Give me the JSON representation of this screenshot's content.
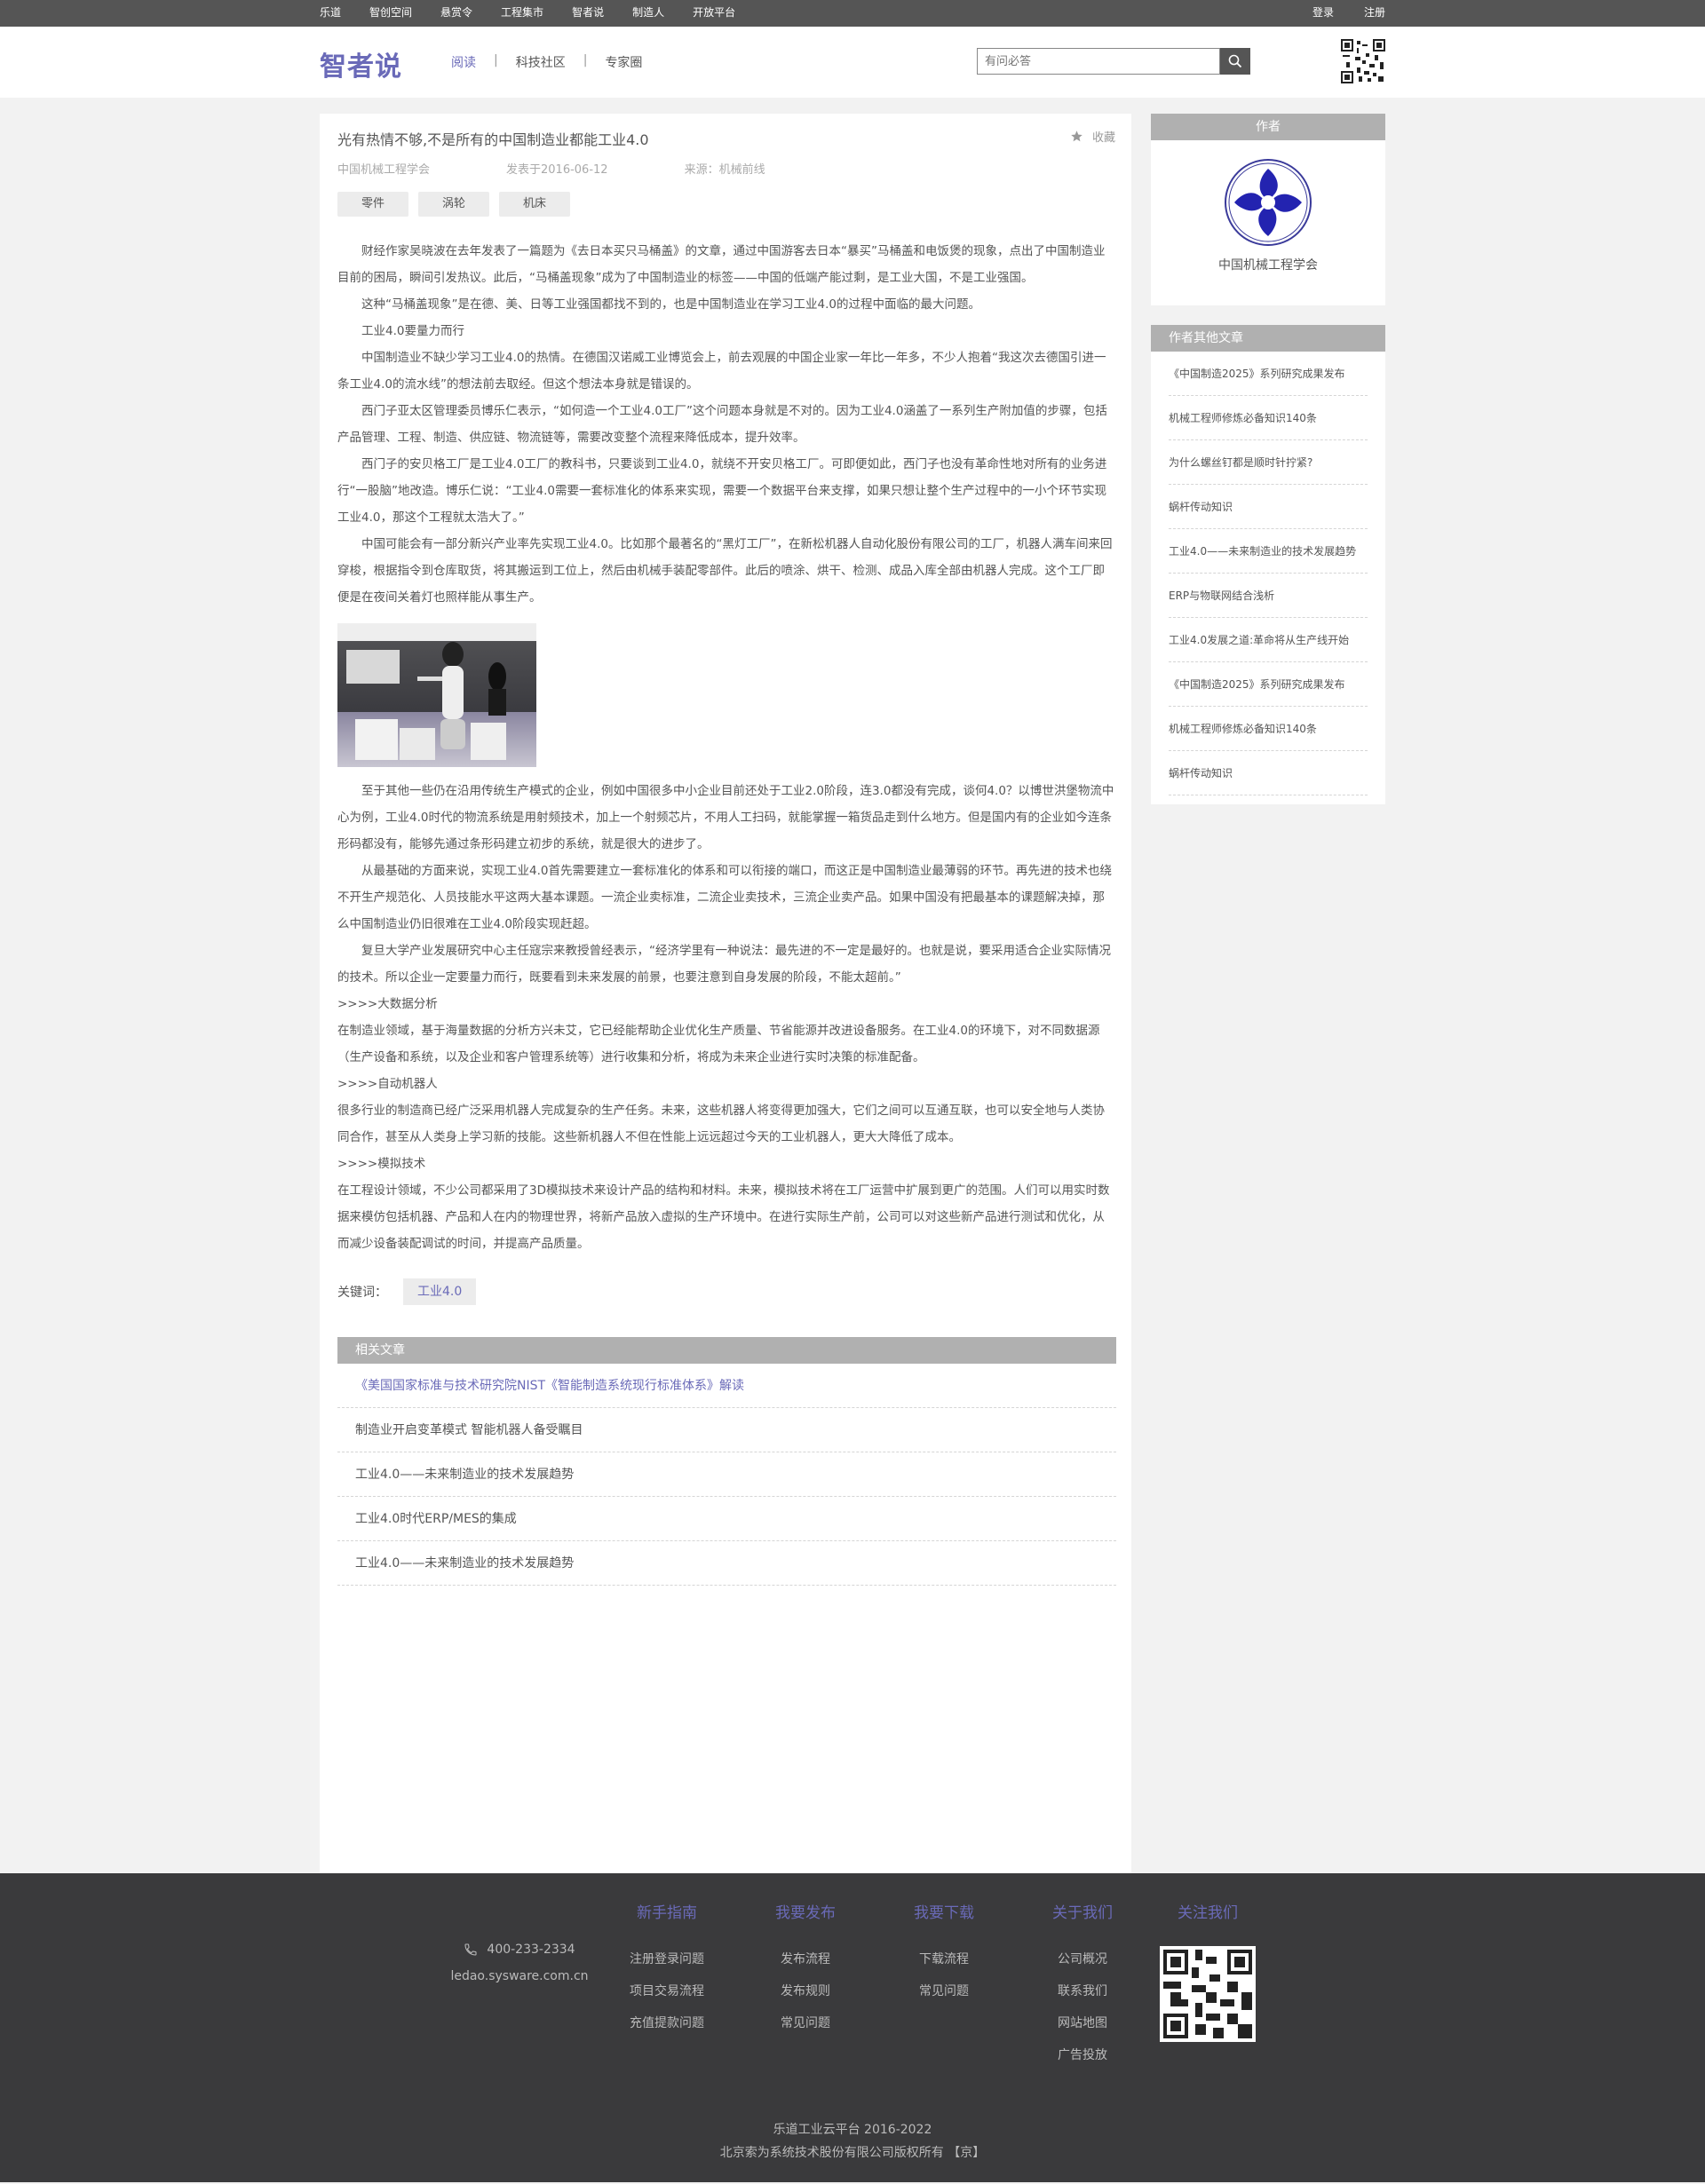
{
  "topbar": {
    "nav": [
      "乐道",
      "智创空间",
      "悬赏令",
      "工程集市",
      "智者说",
      "制造人",
      "开放平台"
    ],
    "login": "登录",
    "register": "注册"
  },
  "header": {
    "logo": "智者说",
    "nav": [
      "阅读",
      "科技社区",
      "专家圈"
    ],
    "search_placeholder": "有问必答"
  },
  "article": {
    "title": "光有热情不够,不是所有的中国制造业都能工业4.0",
    "favorite": "收藏",
    "author": "中国机械工程学会",
    "date": "发表于2016-06-12",
    "source": "来源：机械前线",
    "tags": [
      "零件",
      "涡轮",
      "机床"
    ],
    "paragraphs_a": [
      "财经作家吴晓波在去年发表了一篇题为《去日本买只马桶盖》的文章，通过中国游客去日本“暴买”马桶盖和电饭煲的现象，点出了中国制造业目前的困局，瞬间引发热议。此后，“马桶盖现象”成为了中国制造业的标签——中国的低端产能过剩，是工业大国，不是工业强国。",
      "这种“马桶盖现象”是在德、美、日等工业强国都找不到的，也是中国制造业在学习工业4.0的过程中面临的最大问题。",
      "工业4.0要量力而行",
      "中国制造业不缺少学习工业4.0的热情。在德国汉诺威工业博览会上，前去观展的中国企业家一年比一年多，不少人抱着“我这次去德国引进一条工业4.0的流水线”的想法前去取经。但这个想法本身就是错误的。",
      "西门子亚太区管理委员博乐仁表示，“如何造一个工业4.0工厂”这个问题本身就是不对的。因为工业4.0涵盖了一系列生产附加值的步骤，包括产品管理、工程、制造、供应链、物流链等，需要改变整个流程来降低成本，提升效率。",
      "西门子的安贝格工厂是工业4.0工厂的教科书，只要谈到工业4.0，就绕不开安贝格工厂。可即便如此，西门子也没有革命性地对所有的业务进行“一股脑”地改造。博乐仁说：“工业4.0需要一套标准化的体系来实现，需要一个数据平台来支撑，如果只想让整个生产过程中的一小个环节实现工业4.0，那这个工程就太浩大了。”",
      "中国可能会有一部分新兴产业率先实现工业4.0。比如那个最著名的“黑灯工厂”，在新松机器人自动化股份有限公司的工厂，机器人满车间来回穿梭，根据指令到仓库取货，将其搬运到工位上，然后由机械手装配零部件。此后的喷涂、烘干、检测、成品入库全部由机器人完成。这个工厂即便是在夜间关着灯也照样能从事生产。"
    ],
    "paragraphs_b": [
      "至于其他一些仍在沿用传统生产模式的企业，例如中国很多中小企业目前还处于工业2.0阶段，连3.0都没有完成，谈何4.0？以博世洪堡物流中心为例，工业4.0时代的物流系统是用射频技术，加上一个射频芯片，不用人工扫码，就能掌握一箱货品走到什么地方。但是国内有的企业如今连条形码都没有，能够先通过条形码建立初步的系统，就是很大的进步了。",
      "从最基础的方面来说，实现工业4.0首先需要建立一套标准化的体系和可以衔接的端口，而这正是中国制造业最薄弱的环节。再先进的技术也绕不开生产规范化、人员技能水平这两大基本课题。一流企业卖标准，二流企业卖技术，三流企业卖产品。如果中国没有把最基本的课题解决掉，那么中国制造业仍旧很难在工业4.0阶段实现赶超。",
      "复旦大学产业发展研究中心主任寇宗来教授曾经表示，“经济学里有一种说法：最先进的不一定是最好的。也就是说，要采用适合企业实际情况的技术。所以企业一定要量力而行，既要看到未来发展的前景，也要注意到自身发展的阶段，不能太超前。”"
    ],
    "paragraphs_c": [
      ">>>>大数据分析",
      "在制造业领域，基于海量数据的分析方兴未艾，它已经能帮助企业优化生产质量、节省能源并改进设备服务。在工业4.0的环境下，对不同数据源（生产设备和系统，以及企业和客户管理系统等）进行收集和分析，将成为未来企业进行实时决策的标准配备。",
      ">>>>自动机器人",
      "很多行业的制造商已经广泛采用机器人完成复杂的生产任务。未来，这些机器人将变得更加强大，它们之间可以互通互联，也可以安全地与人类协同合作，甚至从人类身上学习新的技能。这些新机器人不但在性能上远远超过今天的工业机器人，更大大降低了成本。",
      ">>>>模拟技术",
      "在工程设计领域，不少公司都采用了3D模拟技术来设计产品的结构和材料。未来，模拟技术将在工厂运营中扩展到更广的范围。人们可以用实时数据来模仿包括机器、产品和人在内的物理世界，将新产品放入虚拟的生产环境中。在进行实际生产前，公司可以对这些新产品进行测试和优化，从而减少设备装配调试的时间，并提高产品质量。"
    ],
    "keyword_label": "关键词：",
    "keywords": [
      "工业4.0"
    ],
    "related_title": "相关文章",
    "related": [
      "《美国国家标准与技术研究院NIST《智能制造系统现行标准体系》解读",
      "制造业开启变革模式 智能机器人备受瞩目",
      "工业4.0——未来制造业的技术发展趋势",
      "工业4.0时代ERP/MES的集成",
      "工业4.0——未来制造业的技术发展趋势"
    ]
  },
  "sidebar": {
    "author_title": "作者",
    "author_name": "中国机械工程学会",
    "others_title": "作者其他文章",
    "others": [
      "《中国制造2025》系列研究成果发布",
      "机械工程师修炼必备知识140条",
      "为什么螺丝钉都是顺时针拧紧?",
      "蜗杆传动知识",
      "工业4.0——未来制造业的技术发展趋势",
      "ERP与物联网结合浅析",
      "工业4.0发展之道:革命将从生产线开始",
      "《中国制造2025》系列研究成果发布",
      "机械工程师修炼必备知识140条",
      "蜗杆传动知识"
    ]
  },
  "footer": {
    "phone": "400-233-2334",
    "website": "ledao.sysware.com.cn",
    "columns": [
      {
        "title": "新手指南",
        "links": [
          "注册登录问题",
          "项目交易流程",
          "充值提款问题"
        ]
      },
      {
        "title": "我要发布",
        "links": [
          "发布流程",
          "发布规则",
          "常见问题"
        ]
      },
      {
        "title": "我要下载",
        "links": [
          "下载流程",
          "常见问题"
        ]
      },
      {
        "title": "关于我们",
        "links": [
          "公司概况",
          "联系我们",
          "网站地图",
          "广告投放"
        ]
      },
      {
        "title": "关注我们",
        "links": []
      }
    ],
    "copyright_1": "乐道工业云平台 2016-2022",
    "copyright_2": "北京索为系统技术股份有限公司版权所有 【京】"
  },
  "colors": {
    "accent": "#6a6ab8",
    "topbar": "#555555",
    "footer": "#3a3a3c",
    "section_header": "#b0b0b0"
  }
}
